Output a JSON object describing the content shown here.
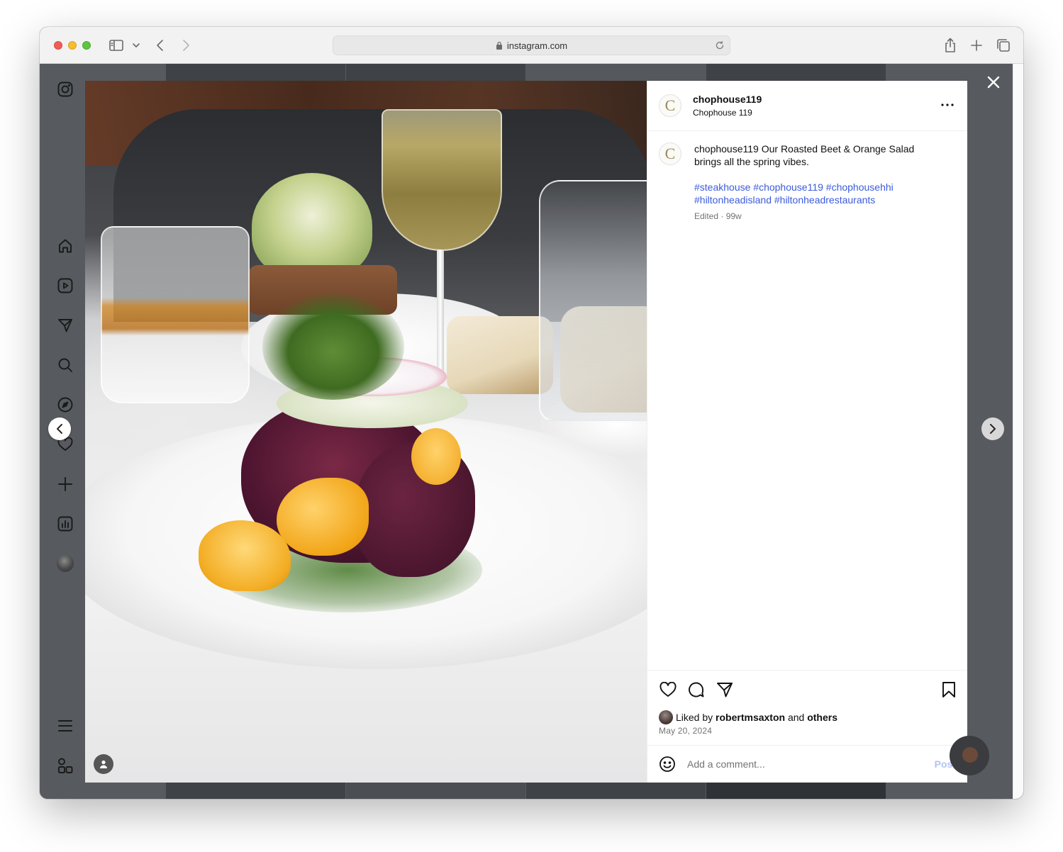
{
  "browser": {
    "url": "instagram.com"
  },
  "sidebar": {
    "items": [
      {
        "name": "instagram-logo-icon"
      },
      {
        "name": "home-icon"
      },
      {
        "name": "reels-icon"
      },
      {
        "name": "messages-icon"
      },
      {
        "name": "search-icon"
      },
      {
        "name": "explore-icon"
      },
      {
        "name": "notifications-icon"
      },
      {
        "name": "create-icon"
      },
      {
        "name": "dashboard-icon"
      },
      {
        "name": "profile-avatar"
      },
      {
        "name": "menu-icon"
      },
      {
        "name": "also-from-meta-icon"
      }
    ]
  },
  "post": {
    "username": "chophouse119",
    "display_name": "Chophouse 119",
    "avatar_letter": "C",
    "caption_user": "chophouse119",
    "caption_text": "Our Roasted Beet & Orange Salad brings all the spring vibes.",
    "hashtags": "#steakhouse #chophouse119 #chophousehhi #hiltonheadisland #hiltonheadrestaurants",
    "meta": "Edited · 99w",
    "liked_prefix": "Liked by",
    "liked_user": "robertmsaxton",
    "liked_and": "and",
    "liked_others": "others",
    "date": "May 20, 2024",
    "comment_placeholder": "Add a comment...",
    "post_label": "Post"
  },
  "colors": {
    "link": "#3b5bdb",
    "post_button_disabled": "#b2c4f7",
    "overlay": "#575a5e"
  }
}
